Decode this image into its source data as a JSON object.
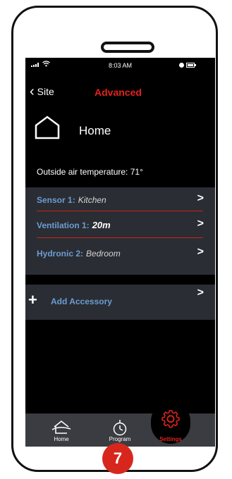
{
  "status_bar": {
    "time": "8:03 AM"
  },
  "nav": {
    "back_label": "Site",
    "title": "Advanced"
  },
  "site": {
    "name": "Home"
  },
  "outside_temp": "Outside air temperature: 71°",
  "accessories": [
    {
      "label": "Sensor 1:",
      "value": "Kitchen"
    },
    {
      "label": "Ventilation 1:",
      "value": "20m"
    },
    {
      "label": "Hydronic 2:",
      "value": "Bedroom"
    }
  ],
  "add_accessory": {
    "label": "Add Accessory"
  },
  "tabs": [
    {
      "label": "Home",
      "icon": "home-icon"
    },
    {
      "label": "Program",
      "icon": "timer-icon"
    },
    {
      "label": "Settings",
      "icon": "gear-icon",
      "active": true
    }
  ],
  "badge": "7",
  "colors": {
    "accent_red": "#e4231b",
    "label_blue": "#6c9dd2",
    "row_bg": "#2a2d33",
    "tabbar_bg": "#3a3c41"
  }
}
